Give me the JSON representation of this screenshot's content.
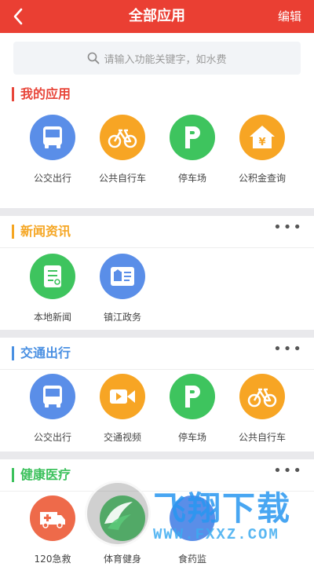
{
  "header": {
    "title": "全部应用",
    "edit_label": "编辑"
  },
  "search": {
    "placeholder": "请输入功能关键字，如水费"
  },
  "colors": {
    "header_bg": "#ea3f33",
    "section_my_accent": "#e8463a",
    "section_news_accent": "#f5a623",
    "section_traffic_accent": "#4a90e2",
    "section_health_accent": "#3cc15c",
    "icon_blue": "#5a8ee8",
    "icon_orange": "#f7a524",
    "icon_green": "#3ec45e",
    "icon_red": "#ee6a4a"
  },
  "sections": [
    {
      "title": "我的应用",
      "has_more": false,
      "apps": [
        {
          "label": "公交出行",
          "icon": "bus-icon"
        },
        {
          "label": "公共自行车",
          "icon": "bicycle-icon"
        },
        {
          "label": "停车场",
          "icon": "parking-icon"
        },
        {
          "label": "公积金查询",
          "icon": "housing-fund-icon"
        }
      ]
    },
    {
      "title": "新闻资讯",
      "has_more": true,
      "more_label": "•••",
      "apps": [
        {
          "label": "本地新闻",
          "icon": "news-list-icon"
        },
        {
          "label": "镇江政务",
          "icon": "government-card-icon"
        }
      ]
    },
    {
      "title": "交通出行",
      "has_more": true,
      "more_label": "•••",
      "apps": [
        {
          "label": "公交出行",
          "icon": "bus-icon"
        },
        {
          "label": "交通视频",
          "icon": "video-camera-icon"
        },
        {
          "label": "停车场",
          "icon": "parking-icon"
        },
        {
          "label": "公共自行车",
          "icon": "bicycle-icon"
        }
      ]
    },
    {
      "title": "健康医疗",
      "has_more": true,
      "more_label": "•••",
      "apps": [
        {
          "label": "120急救",
          "icon": "ambulance-icon"
        },
        {
          "label": "体育健身",
          "icon": "fitness-icon"
        },
        {
          "label": "食药监",
          "icon": "food-drug-icon"
        }
      ]
    }
  ],
  "watermark": {
    "brand": "飞翔下载",
    "url": "WWW.FXXZ.COM"
  }
}
